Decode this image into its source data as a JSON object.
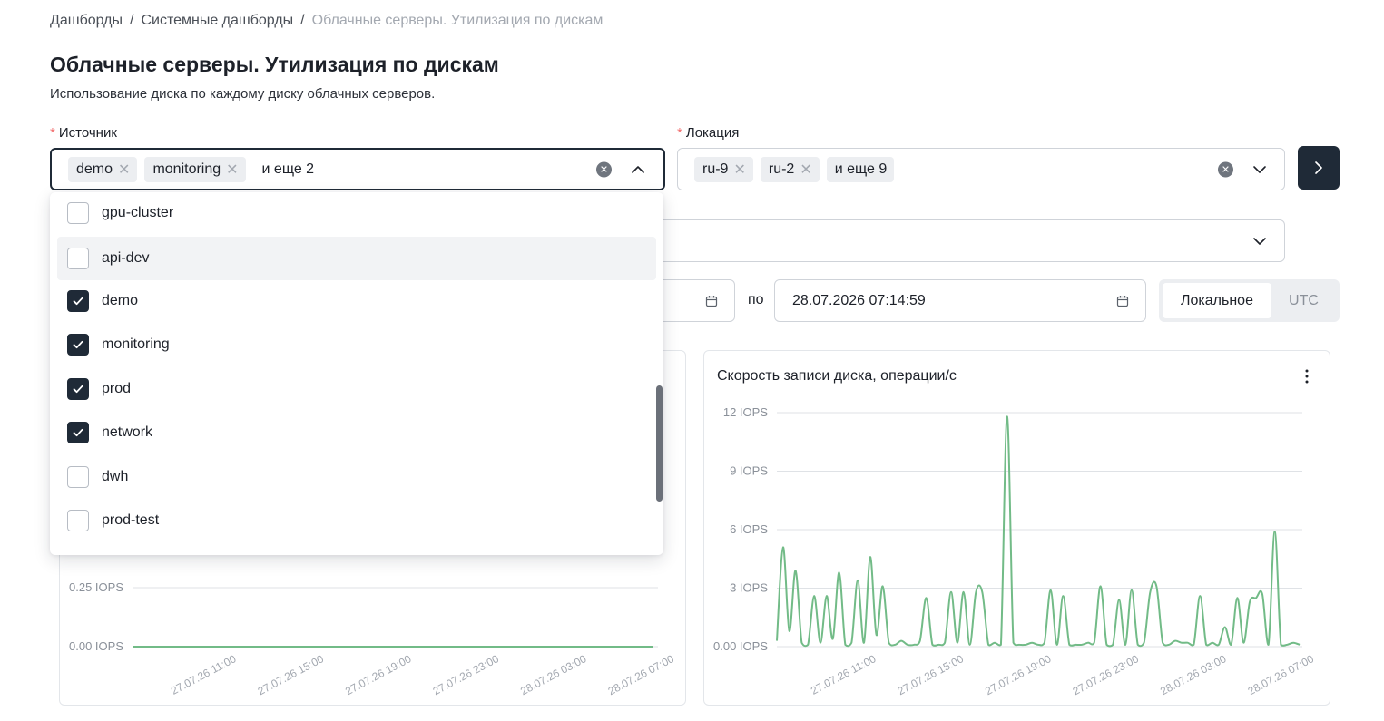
{
  "breadcrumb": {
    "items": [
      "Дашборды",
      "Системные дашборды"
    ],
    "separator": "/",
    "current": "Облачные серверы. Утилизация по дискам"
  },
  "page": {
    "title": "Облачные серверы. Утилизация по дискам",
    "description": "Использование диска по каждому диску облачных серверов."
  },
  "filters": {
    "source": {
      "label": "Источник",
      "required_mark": "*",
      "tags": [
        "demo",
        "monitoring"
      ],
      "more": "и еще 2",
      "clear_icon": "clear-circle-icon",
      "expanded": true
    },
    "location": {
      "label": "Локация",
      "required_mark": "*",
      "tags": [
        "ru-9",
        "ru-2"
      ],
      "more": "и еще 9",
      "clear_icon": "clear-circle-icon"
    },
    "go_button_icon": "chevron-right-icon",
    "date_to_label": "по",
    "date_to": "28.07.2026 07:14:59",
    "timezone": {
      "options": [
        "Локальное",
        "UTC"
      ],
      "selected": "Локальное"
    }
  },
  "dropdown": {
    "options": [
      {
        "label": "gpu-cluster",
        "checked": false
      },
      {
        "label": "api-dev",
        "checked": false,
        "hovered": true
      },
      {
        "label": "demo",
        "checked": true
      },
      {
        "label": "monitoring",
        "checked": true
      },
      {
        "label": "prod",
        "checked": true
      },
      {
        "label": "network",
        "checked": true
      },
      {
        "label": "dwh",
        "checked": false
      },
      {
        "label": "prod-test",
        "checked": false
      }
    ]
  },
  "colors": {
    "accent": "#1f2a37",
    "series": "#72bb87",
    "required": "#f26d6d"
  },
  "chart_data": [
    {
      "type": "line",
      "title": "",
      "y_tick_labels": [
        "0.25 IOPS",
        "0.00 IOPS"
      ],
      "y_ticks": [
        0.25,
        0
      ],
      "x_tick_labels": [
        "27.07.26 11:00",
        "27.07.26 15:00",
        "27.07.26 19:00",
        "27.07.26 23:00",
        "28.07.26 03:00",
        "28.07.26 07:00"
      ],
      "series": [
        {
          "x": [
            0,
            1
          ],
          "y": [
            0,
            0
          ]
        }
      ]
    },
    {
      "type": "line",
      "title": "Скорость записи диска, операции/с",
      "y_tick_labels": [
        "12 IOPS",
        "9 IOPS",
        "6 IOPS",
        "3 IOPS",
        "0.00 IOPS"
      ],
      "y_ticks": [
        12,
        9,
        6,
        3,
        0
      ],
      "ylim": [
        0,
        12
      ],
      "x_tick_labels": [
        "27.07.26 11:00",
        "27.07.26 15:00",
        "27.07.26 19:00",
        "27.07.26 23:00",
        "28.07.26 03:00",
        "28.07.26 07:00"
      ],
      "grid": true,
      "series": [
        {
          "y": [
            0.3,
            5.1,
            0.8,
            3.9,
            0.2,
            0.1,
            2.6,
            0.2,
            2.6,
            0.4,
            3.8,
            0.1,
            0.2,
            3.4,
            0.2,
            4.6,
            0.6,
            3.1,
            0.2,
            0.1,
            0.3,
            0.1,
            0.1,
            0.3,
            2.5,
            0.1,
            0.1,
            0.2,
            2.8,
            0.2,
            2.8,
            0.1,
            2.8,
            2.8,
            0.1,
            0.2,
            0.1,
            11.8,
            0.2,
            0.1,
            0.1,
            0.2,
            0.1,
            0.2,
            2.9,
            0.1,
            2.6,
            0.1,
            0.1,
            0.1,
            0.2,
            0.2,
            3.1,
            0.1,
            0.1,
            2.4,
            0.1,
            2.9,
            0.1,
            0.2,
            2.8,
            3.1,
            0.2,
            0.1,
            0.3,
            0.2,
            0.2,
            0.1,
            2.6,
            0.1,
            0.2,
            0.1,
            1.0,
            0.1,
            2.5,
            0.2,
            2.3,
            2.5,
            2.7,
            0.1,
            5.9,
            0.1,
            0.1,
            0.2,
            0.1
          ]
        }
      ]
    }
  ]
}
